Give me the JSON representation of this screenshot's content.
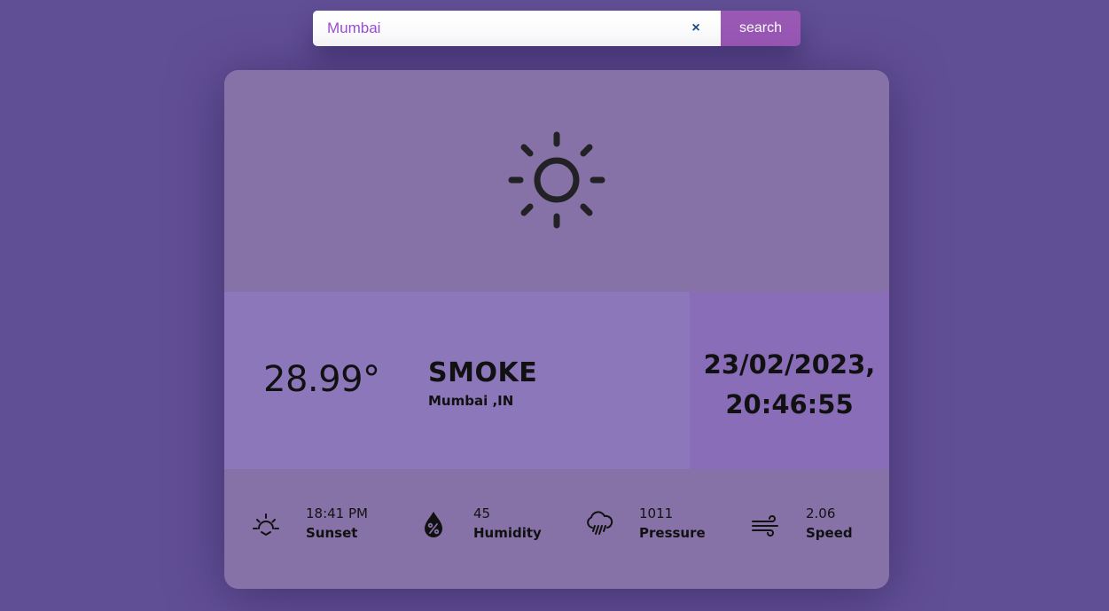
{
  "search": {
    "value": "Mumbai",
    "clear_label": "×",
    "button_label": "search"
  },
  "weather": {
    "icon": "sun-icon",
    "temperature": "28.99°",
    "condition": "SMOKE",
    "location": "Mumbai ,IN",
    "date": "23/02/2023,",
    "time": "20:46:55"
  },
  "stats": [
    {
      "icon": "sunset-icon",
      "value": "18:41 PM",
      "label": "Sunset"
    },
    {
      "icon": "humidity-icon",
      "value": "45",
      "label": "Humidity"
    },
    {
      "icon": "rain-cloud-icon",
      "value": "1011",
      "label": "Pressure"
    },
    {
      "icon": "wind-icon",
      "value": "2.06",
      "label": "Speed"
    }
  ],
  "colors": {
    "background": "#614f95",
    "card": "#8672a7",
    "temp_panel": "#8d77bb",
    "date_panel": "#8a6db8",
    "search_button": "#9b59b6",
    "input_text": "#9a4fd6"
  }
}
